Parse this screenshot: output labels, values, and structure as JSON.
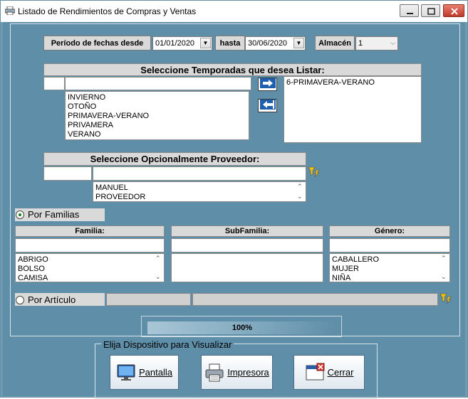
{
  "window": {
    "title": "Listado de Rendimientos de Compras y Ventas"
  },
  "dates": {
    "from_label": "Período de fechas desde",
    "from_value": "01/01/2020",
    "to_label": "hasta",
    "to_value": "30/06/2020",
    "warehouse_label": "Almacén",
    "warehouse_value": "1"
  },
  "seasons": {
    "header": "Seleccione Temporadas que desea Listar:",
    "available": [
      "INVIERNO",
      "OTOÑO",
      "PRIMAVERA-VERANO",
      "PRIVAMERA",
      "VERANO"
    ],
    "selected": [
      "6-PRIMAVERA-VERANO"
    ]
  },
  "supplier": {
    "header": "Seleccione Opcionalmente Proveedor:",
    "items": [
      "MANUEL",
      "PROVEEDOR"
    ]
  },
  "by_family": {
    "label": "Por Familias",
    "family_header": "Familia:",
    "subfamily_header": "SubFamilia:",
    "gender_header": "Género:",
    "families": [
      "ABRIGO",
      "BOLSO",
      "CAMISA"
    ],
    "genders": [
      "CABALLERO",
      "MUJER",
      "NIÑA"
    ]
  },
  "by_article": {
    "label": "Por Artículo"
  },
  "progress": {
    "text": "100%",
    "value": 100
  },
  "device": {
    "title": "Elija Dispositivo para Visualizar",
    "screen_label": "Pantalla",
    "printer_label": "Impresora",
    "close_label": "Cerrar"
  },
  "icons": {
    "app": "printer-icon",
    "filter": "filter-lightning-icon",
    "move_right": "arrow-right-icon",
    "move_left": "arrow-left-icon",
    "screen": "monitor-icon",
    "printer": "printer-icon",
    "close": "close-window-icon"
  },
  "colors": {
    "client_background": "#5f8ea8",
    "header_grey": "#d9d9d9",
    "close_button": "#c0392b"
  }
}
